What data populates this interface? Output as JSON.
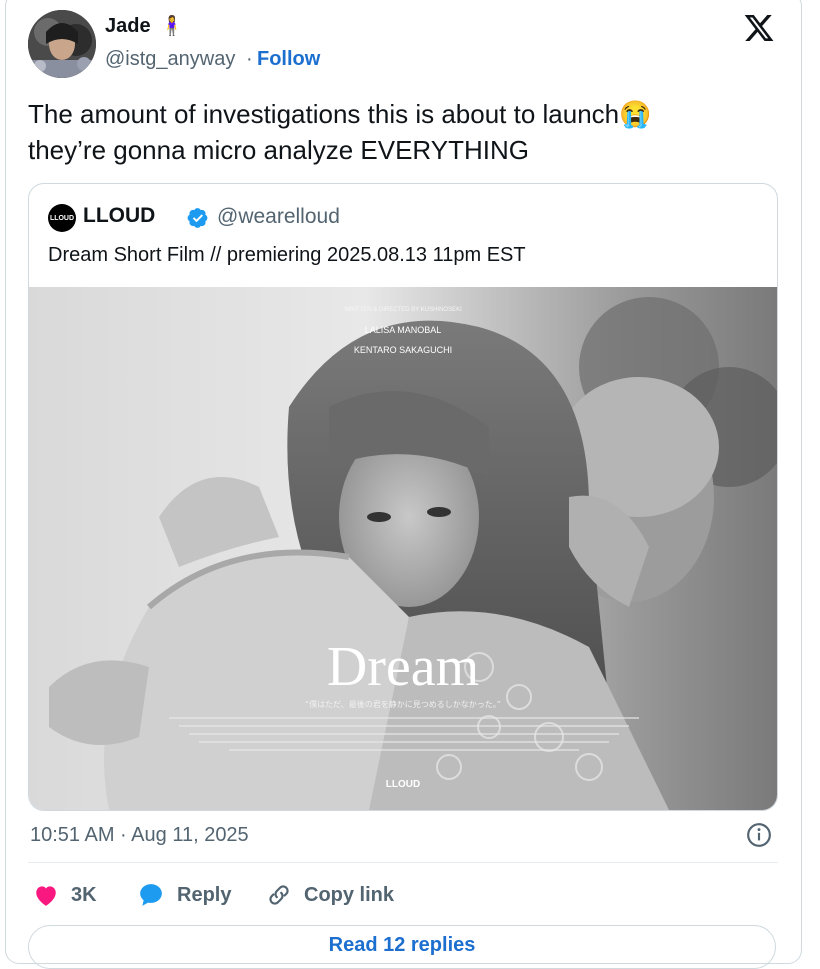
{
  "author": {
    "name": "Jade",
    "name_emoji": "🧍‍♀️",
    "handle": "@istg_anyway",
    "separator": "·",
    "follow_label": "Follow"
  },
  "brand_icon": "x-logo-icon",
  "tweet": {
    "line1": "The amount of investigations this is about to launch😭",
    "line2": "they’re gonna micro analyze EVERYTHING"
  },
  "quote": {
    "logo_text": "LLOUD",
    "name": "LLOUD",
    "handle": "@wearelloud",
    "text": "Dream Short Film // premiering 2025.08.13 11pm EST",
    "poster": {
      "credit_top": "WRITTEN & DIRECTED BY KUSHINOSEKI",
      "cast1": "LALISA MANOBAL",
      "cast2": "KENTARO SAKAGUCHI",
      "title": "Dream",
      "tagline": "“僕はただ、最後の君を静かに見つめるしかなかった。”",
      "brand": "LLOUD"
    }
  },
  "timestamp": "10:51 AM · Aug 11, 2025",
  "actions": {
    "likes": "3K",
    "reply": "Reply",
    "copy_link": "Copy link"
  },
  "read_replies": "Read 12 replies",
  "colors": {
    "accent": "#1d6fcf",
    "like": "#f91880",
    "reply": "#1d9bf0",
    "muted": "#536471",
    "border": "#cfd9de"
  }
}
